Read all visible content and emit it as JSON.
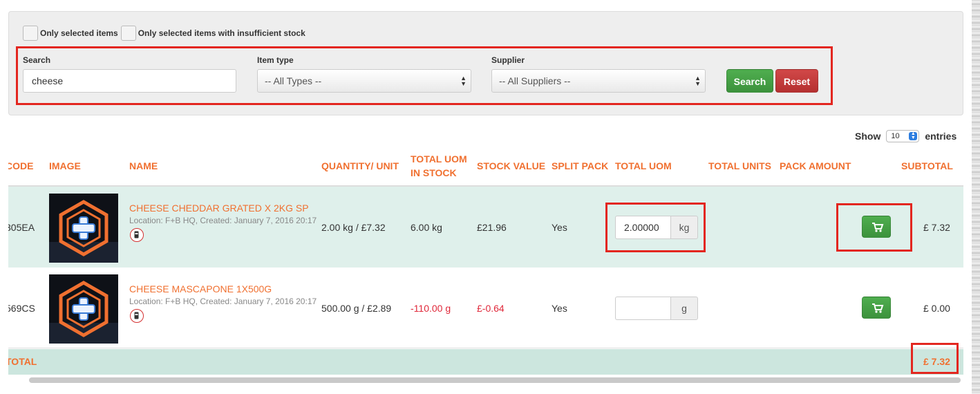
{
  "filters": {
    "only_selected_label": "Only selected items",
    "only_insufficient_label": "Only selected items with insufficient stock",
    "search_label": "Search",
    "search_value": "cheese",
    "item_type_label": "Item type",
    "item_type_value": "-- All Types --",
    "supplier_label": "Supplier",
    "supplier_value": "-- All Suppliers --",
    "search_button": "Search",
    "reset_button": "Reset"
  },
  "entries": {
    "show_label": "Show",
    "value": "10",
    "entries_label": "entries"
  },
  "table": {
    "columns": {
      "code": "CODE",
      "image": "IMAGE",
      "name": "NAME",
      "quantity_unit": "QUANTITY/ UNIT",
      "total_uom_in_stock_1": "TOTAL UOM",
      "total_uom_in_stock_2": "IN STOCK",
      "stock_value": "STOCK VALUE",
      "split_pack": "SPLIT PACK",
      "total_uom": "TOTAL UOM",
      "total_units": "TOTAL UNITS",
      "pack_amount": "PACK AMOUNT",
      "subtotal": "SUBTOTAL"
    },
    "rows": [
      {
        "code": "305EA",
        "name": "CHEESE CHEDDAR GRATED X 2KG SP",
        "meta": "Location: F+B HQ, Created: January 7, 2016 20:17",
        "quantity_unit": "2.00 kg / £7.32",
        "total_uom_in_stock": "6.00 kg",
        "stock_value": "£21.96",
        "split_pack": "Yes",
        "uom_value": "2.00000",
        "uom_unit": "kg",
        "subtotal": "£ 7.32"
      },
      {
        "code": "569CS",
        "name": "CHEESE MASCAPONE 1X500G",
        "meta": "Location: F+B HQ, Created: January 7, 2016 20:17",
        "quantity_unit": "500.00 g / £2.89",
        "total_uom_in_stock": "-110.00 g",
        "stock_value": "£-0.64",
        "split_pack": "Yes",
        "uom_value": "",
        "uom_unit": "g",
        "subtotal": "£ 0.00"
      }
    ],
    "total_label": "TOTAL",
    "total_value": "£ 7.32"
  },
  "icons": {
    "cart": "shopping-cart-icon",
    "item_status": "item-status-icon",
    "select_arrows": "up-down-arrows-icon"
  },
  "colors": {
    "accent_orange": "#f07030",
    "highlight_red": "#e3261f",
    "button_green": "#449d44",
    "button_red": "#c23b3b",
    "negative_red": "#e0283a",
    "row_highlight": "#dff0eb"
  }
}
